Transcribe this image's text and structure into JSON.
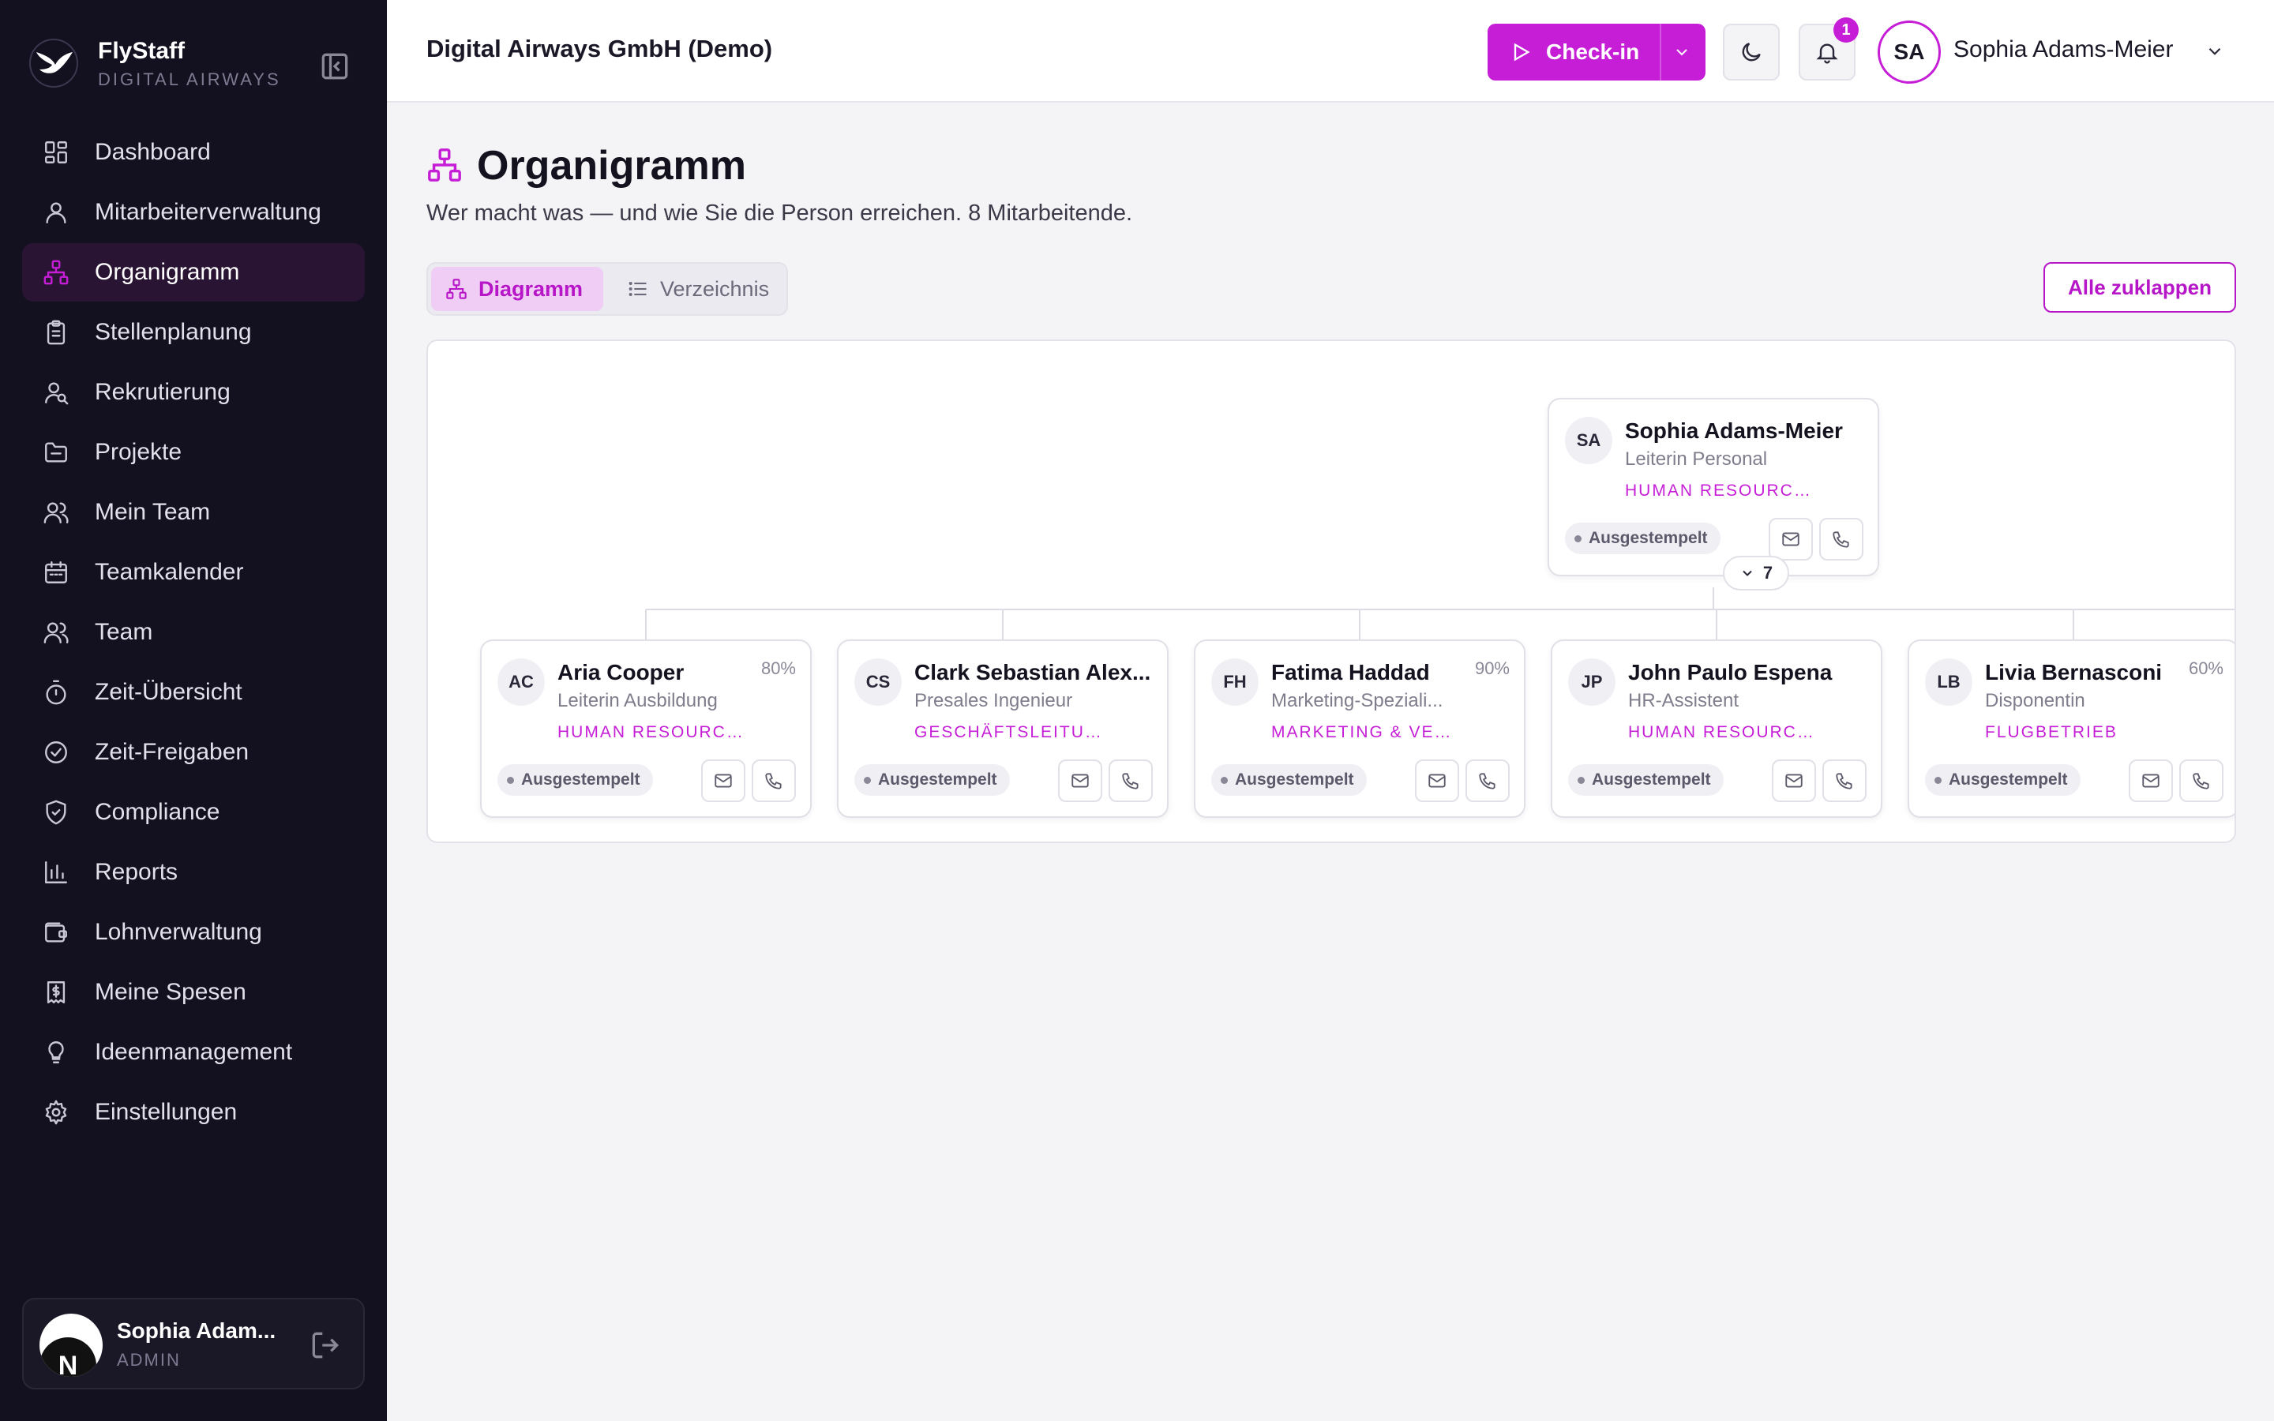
{
  "brand": {
    "name": "FlyStaff",
    "subtitle": "DIGITAL AIRWAYS"
  },
  "sidebar": {
    "items": [
      {
        "label": "Dashboard",
        "icon": "dashboard-icon",
        "active": false
      },
      {
        "label": "Mitarbeiterverwaltung",
        "icon": "user-icon",
        "active": false
      },
      {
        "label": "Organigramm",
        "icon": "org-chart-icon",
        "active": true
      },
      {
        "label": "Stellenplanung",
        "icon": "clipboard-icon",
        "active": false
      },
      {
        "label": "Rekrutierung",
        "icon": "user-search-icon",
        "active": false
      },
      {
        "label": "Projekte",
        "icon": "folder-icon",
        "active": false
      },
      {
        "label": "Mein Team",
        "icon": "users-icon",
        "active": false
      },
      {
        "label": "Teamkalender",
        "icon": "calendar-icon",
        "active": false
      },
      {
        "label": "Team",
        "icon": "users-icon",
        "active": false
      },
      {
        "label": "Zeit-Übersicht",
        "icon": "timer-icon",
        "active": false
      },
      {
        "label": "Zeit-Freigaben",
        "icon": "check-circle-icon",
        "active": false
      },
      {
        "label": "Compliance",
        "icon": "shield-icon",
        "active": false
      },
      {
        "label": "Reports",
        "icon": "bar-chart-icon",
        "active": false
      },
      {
        "label": "Lohnverwaltung",
        "icon": "wallet-icon",
        "active": false
      },
      {
        "label": "Meine Spesen",
        "icon": "receipt-icon",
        "active": false
      },
      {
        "label": "Ideenmanagement",
        "icon": "lightbulb-icon",
        "active": false
      },
      {
        "label": "Einstellungen",
        "icon": "gear-icon",
        "active": false
      }
    ],
    "user": {
      "name": "Sophia Adam...",
      "role": "ADMIN",
      "badge": "N"
    }
  },
  "header": {
    "company": "Digital Airways GmbH (Demo)",
    "checkin_label": "Check-in",
    "notification_count": "1",
    "avatar_initials": "SA",
    "username": "Sophia Adams-Meier"
  },
  "page": {
    "title": "Organigramm",
    "subtitle": "Wer macht was — und wie Sie die Person erreichen. 8 Mitarbeitende.",
    "view_diagram": "Diagramm",
    "view_list": "Verzeichnis",
    "collapse_all": "Alle zuklappen"
  },
  "org": {
    "root": {
      "initials": "SA",
      "name": "Sophia Adams-Meier",
      "role": "Leiterin Personal",
      "dept": "HUMAN RESOURCES",
      "status": "Ausgestempelt",
      "pct": "",
      "children_count": "7"
    },
    "children": [
      {
        "initials": "AC",
        "name": "Aria Cooper",
        "role": "Leiterin Ausbildung",
        "dept": "HUMAN RESOURCES",
        "status": "Ausgestempelt",
        "pct": "80%"
      },
      {
        "initials": "CS",
        "name": "Clark Sebastian Alex...",
        "role": "Presales Ingenieur",
        "dept": "GESCHÄFTSLEITUNG",
        "status": "Ausgestempelt",
        "pct": ""
      },
      {
        "initials": "FH",
        "name": "Fatima Haddad",
        "role": "Marketing-Speziali...",
        "dept": "MARKETING & VERT...",
        "status": "Ausgestempelt",
        "pct": "90%"
      },
      {
        "initials": "JP",
        "name": "John Paulo Espena",
        "role": "HR-Assistent",
        "dept": "HUMAN RESOURCES",
        "status": "Ausgestempelt",
        "pct": ""
      },
      {
        "initials": "LB",
        "name": "Livia Bernasconi",
        "role": "Disponentin",
        "dept": "FLUGBETRIEB",
        "status": "Ausgestempelt",
        "pct": "60%"
      }
    ]
  },
  "colors": {
    "accent": "#c51ed6",
    "sidebar_bg": "#13111f",
    "active_bg": "#2a1434"
  }
}
